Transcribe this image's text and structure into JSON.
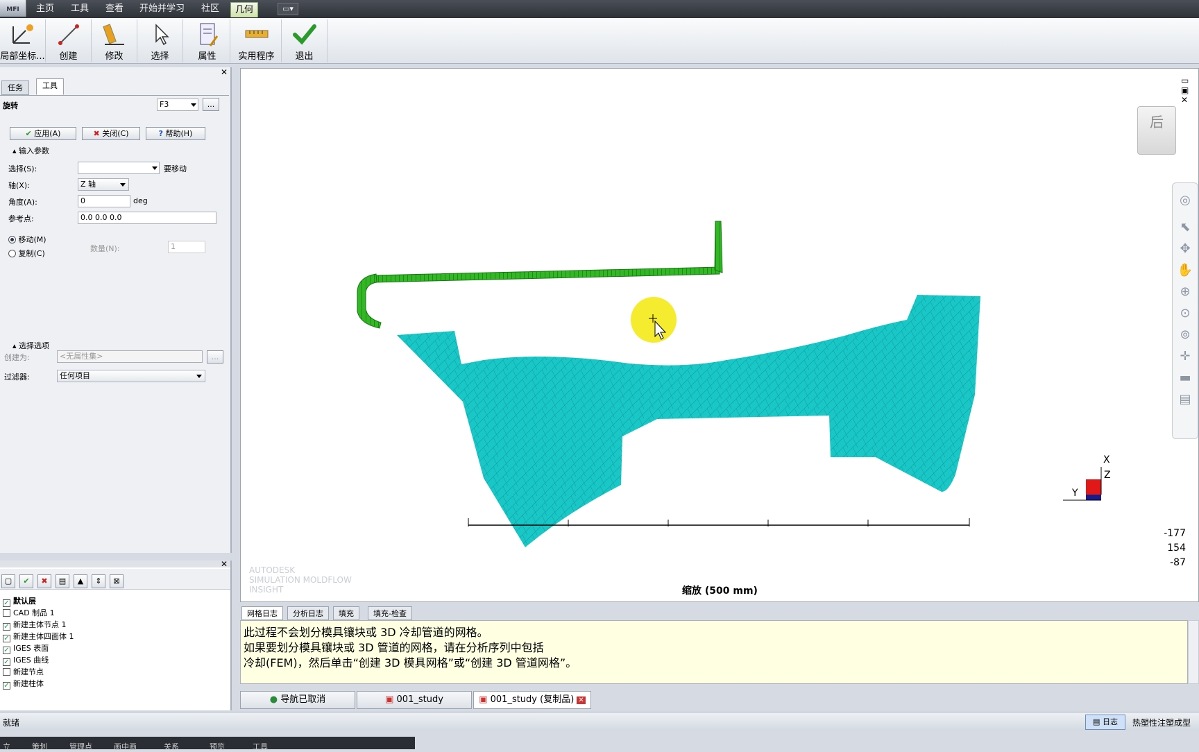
{
  "app": {
    "logo": "MFI"
  },
  "menu": {
    "items": [
      "主页",
      "工具",
      "查看",
      "开始并学习",
      "社区",
      "几何"
    ],
    "active_index": 5,
    "extra": "▾"
  },
  "ribbon": {
    "buttons": [
      {
        "label": "局部坐标...",
        "icon": "local-coordinate-icon"
      },
      {
        "label": "创建",
        "icon": "create-icon"
      },
      {
        "label": "修改",
        "icon": "modify-icon"
      },
      {
        "label": "选择",
        "icon": "select-cursor-icon"
      },
      {
        "label": "属性",
        "icon": "properties-icon"
      },
      {
        "label": "实用程序",
        "icon": "utility-ruler-icon"
      },
      {
        "label": "退出",
        "icon": "exit-check-icon"
      }
    ]
  },
  "leftpanel": {
    "tabs": [
      "任务",
      "工具"
    ],
    "active_tab": 1,
    "tool_name": "旋转",
    "tool_shortcut": "F3",
    "more": "...",
    "apply": "应用(A)",
    "close": "关闭(C)",
    "help": "帮助(H)",
    "input_section": "输入参数",
    "select_label": "选择(S):",
    "select_value": "",
    "select_hint": "要移动",
    "axis_label": "轴(X):",
    "axis_value": "Z 轴",
    "angle_label": "角度(A):",
    "angle_value": "0",
    "angle_unit": "deg",
    "refpoint_label": "参考点:",
    "refpoint_value": "0.0 0.0 0.0",
    "move_label": "移动(M)",
    "copy_label": "复制(C)",
    "count_label": "数量(N):",
    "count_value": "1",
    "options_section": "选择选项",
    "create_as_label": "创建为:",
    "create_as_value": "<无属性集>",
    "filter_label": "过滤器:",
    "filter_value": "任何项目"
  },
  "layers": {
    "items": [
      {
        "label": "默认层",
        "checked": true,
        "bold": true
      },
      {
        "label": "CAD 制品 1",
        "checked": false
      },
      {
        "label": "新建主体节点 1",
        "checked": true
      },
      {
        "label": "新建主体四面体 1",
        "checked": true
      },
      {
        "label": "IGES 表面",
        "checked": true
      },
      {
        "label": "IGES 曲线",
        "checked": true
      },
      {
        "label": "新建节点",
        "checked": false
      },
      {
        "label": "新建柱体",
        "checked": true
      }
    ]
  },
  "viewport": {
    "watermark": [
      "AUTODESK",
      "SIMULATION MOLDFLOW",
      "INSIGHT"
    ],
    "scale_label": "缩放 (500 mm)",
    "coords": [
      "-177",
      "154",
      "-87"
    ],
    "axis_labels": {
      "x": "X",
      "y": "Y",
      "z": "Z"
    },
    "viewcube_label": "后",
    "colors": {
      "part": "#19c7c6",
      "pipe": "#2aa11c",
      "cursor_highlight": "#f4ea1a"
    }
  },
  "log": {
    "tabs": [
      "网格日志",
      "分析日志",
      "填充",
      "填充-检查"
    ],
    "active_tab": 0,
    "lines": [
      "此过程不会划分模具镶块或 3D 冷却管道的网格。",
      "如果要划分模具镶块或 3D 管道的网格，请在分析序列中包括",
      "冷却(FEM)，然后单击“创建 3D 模具网格”或“创建 3D 管道网格”。"
    ]
  },
  "doc_tabs": [
    "导航已取消",
    "001_study",
    "001_study (复制品)"
  ],
  "status": {
    "left": "就绪",
    "log_button": "日志",
    "right": "热塑性注塑成型"
  },
  "taskbar": [
    "立",
    "策划",
    "管理点",
    "画中画",
    "关系",
    "预览",
    "工具"
  ]
}
